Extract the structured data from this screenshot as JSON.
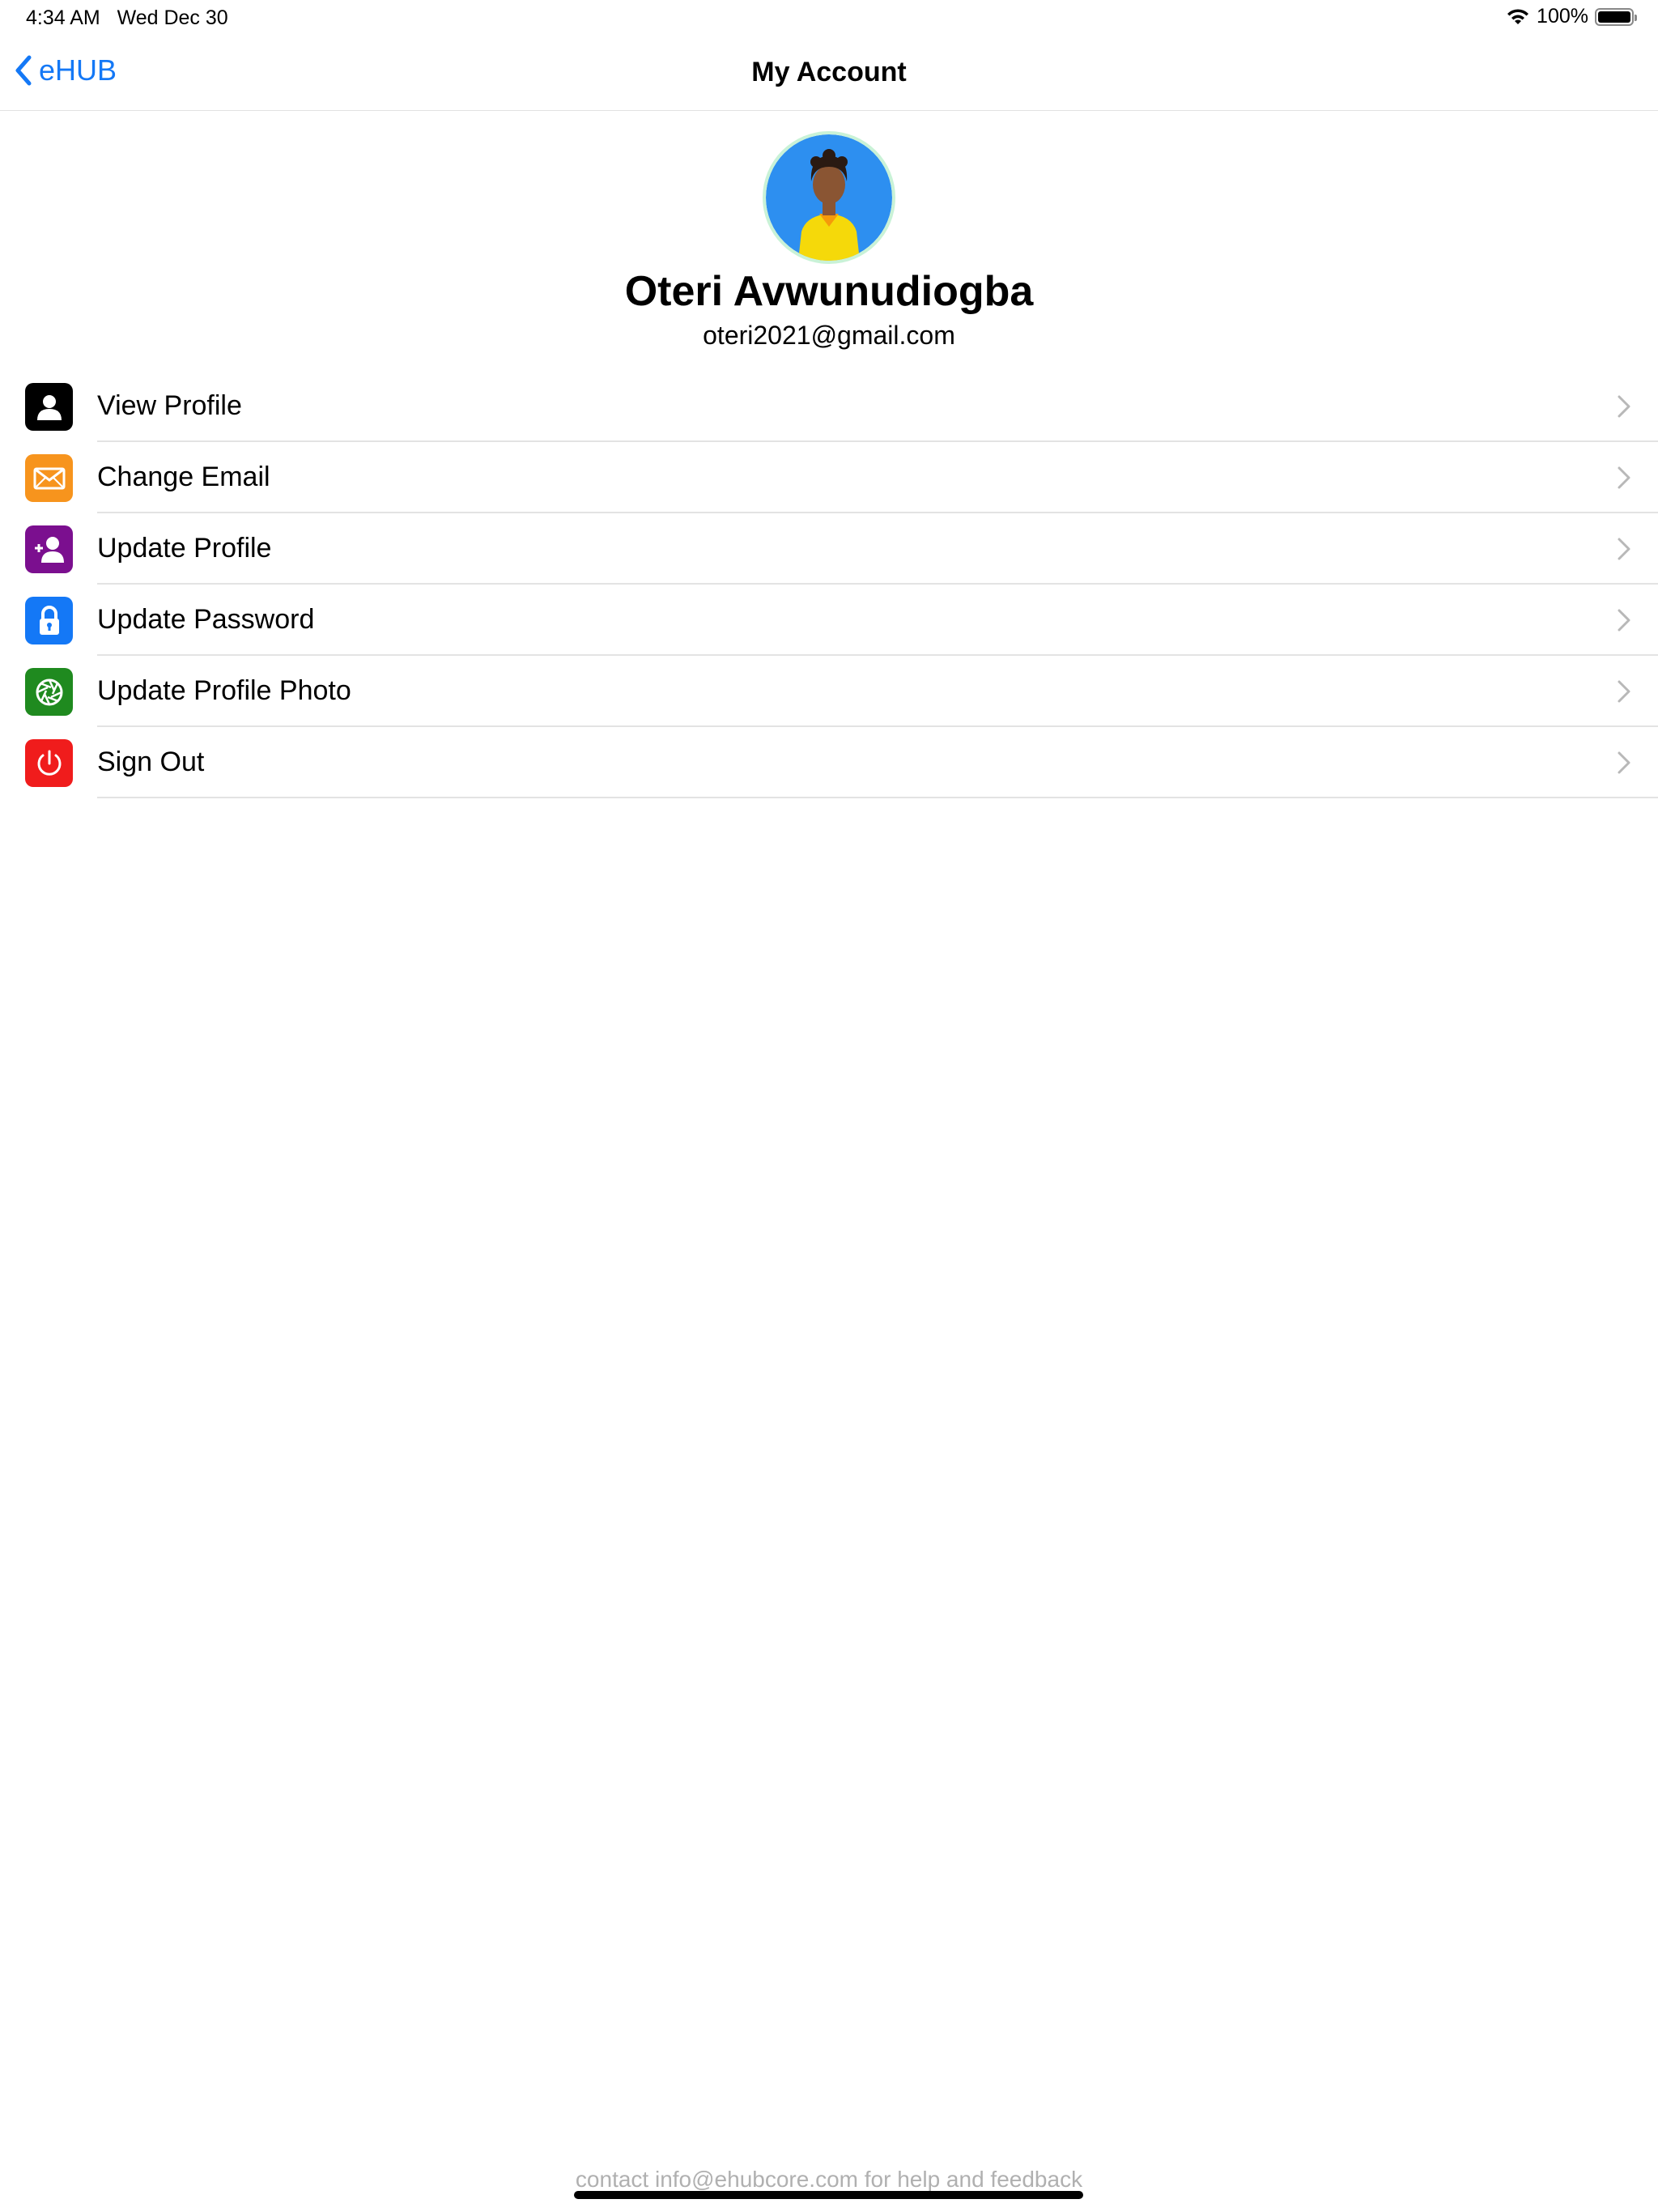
{
  "status_bar": {
    "time": "4:34 AM",
    "date": "Wed Dec 30",
    "battery_percent": "100%",
    "battery_level": 1.0
  },
  "nav": {
    "back_label": "eHUB",
    "title": "My Account",
    "accent_color": "#1478f6"
  },
  "profile": {
    "name": "Oteri Avwunudiogba",
    "email": "oteri2021@gmail.com"
  },
  "menu": {
    "items": [
      {
        "label": "View Profile",
        "icon": "person-icon",
        "color": "#000000"
      },
      {
        "label": "Change Email",
        "icon": "envelope-icon",
        "color": "#f7941d"
      },
      {
        "label": "Update Profile",
        "icon": "person-add-icon",
        "color": "#7b0f8f"
      },
      {
        "label": "Update Password",
        "icon": "lock-icon",
        "color": "#1478f6"
      },
      {
        "label": "Update Profile Photo",
        "icon": "camera-aperture-icon",
        "color": "#1f8a1f"
      },
      {
        "label": "Sign Out",
        "icon": "power-icon",
        "color": "#f01c1c"
      }
    ]
  },
  "footer": {
    "text": "contact info@ehubcore.com for help and feedback"
  }
}
